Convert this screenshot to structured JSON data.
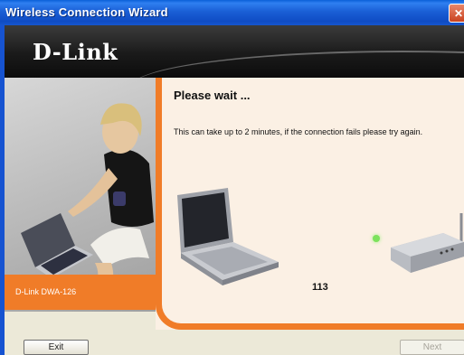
{
  "window": {
    "title": "Wireless Connection Wizard"
  },
  "header": {
    "logo": "D-Link"
  },
  "sidebar": {
    "product": "D-Link DWA-126"
  },
  "main": {
    "heading": "Please wait ...",
    "message": "This can take up to 2 minutes, if the connection fails please try again.",
    "counter": "113"
  },
  "buttons": {
    "exit": "Exit",
    "next": "Next"
  },
  "colors": {
    "accent": "#f07c28",
    "titlebar": "#0f4cc4",
    "panel": "#fbf0e4",
    "status": "#7ce25c"
  },
  "icons": [
    "close-icon",
    "laptop-icon",
    "router-icon",
    "status-dot"
  ]
}
